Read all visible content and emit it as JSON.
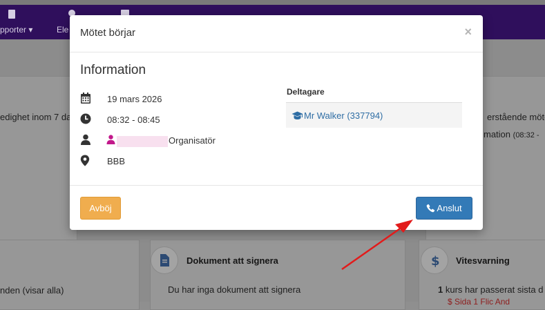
{
  "nav": {
    "items": [
      {
        "label": "pporter",
        "icon": "document-icon"
      },
      {
        "label": "Ele",
        "icon": "person-icon"
      },
      {
        "label": "",
        "icon": "list-icon"
      }
    ],
    "caret": "▾"
  },
  "background": {
    "left_text_1": "edighet inom 7 da",
    "right_text_1": "erstående möte",
    "right_text_2": "mation",
    "right_text_2_time": "(08:32 -",
    "documents": {
      "title": "Dokument att signera",
      "message": "Du har inga dokument att signera"
    },
    "fines": {
      "title": "Vitesvarning",
      "message_count": "1",
      "message_text": " kurs har passerat sista d"
    },
    "left_bottom_text": "nden (visar alla)",
    "red_partial": "$  Sida  1 Flic  And"
  },
  "modal": {
    "title": "Mötet börjar",
    "close": "×",
    "section_title": "Information",
    "date": "19 mars 2026",
    "time": "08:32 - 08:45",
    "organizer_role": "Organisatör",
    "location": "BBB",
    "participants_heading": "Deltagare",
    "participant": "Mr Walker (337794)",
    "cancel_label": "Avböj",
    "connect_label": "Anslut"
  },
  "colors": {
    "navbar": "#2f0f5c",
    "primary": "#337ab7",
    "warning": "#f0ad4e",
    "link": "#2e6da4",
    "annotation_arrow": "#e21b1b"
  }
}
